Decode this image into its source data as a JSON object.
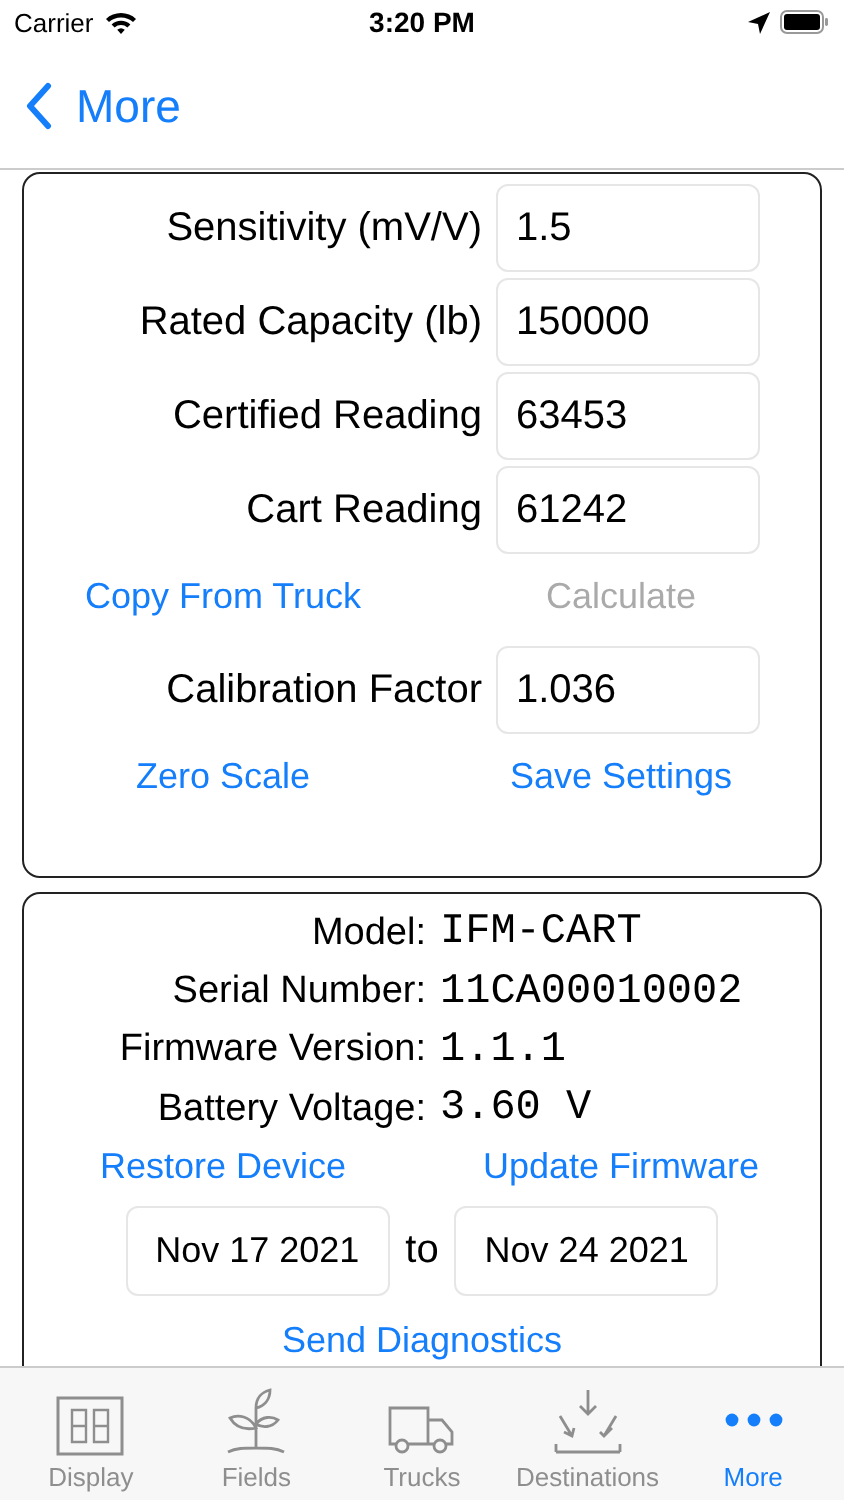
{
  "status_bar": {
    "carrier": "Carrier",
    "time": "3:20 PM"
  },
  "nav": {
    "back_label": "More"
  },
  "settings": {
    "fields": [
      {
        "label": "Sensitivity (mV/V)",
        "value": "1.5"
      },
      {
        "label": "Rated Capacity (lb)",
        "value": "150000"
      },
      {
        "label": "Certified Reading",
        "value": "63453"
      },
      {
        "label": "Cart Reading",
        "value": "61242"
      }
    ],
    "actions": [
      {
        "label": "Copy From Truck",
        "disabled": false
      },
      {
        "label": "Calculate",
        "disabled": true
      }
    ],
    "factor": {
      "label": "Calibration Factor",
      "value": "1.036"
    },
    "buttons": [
      {
        "label": "Zero Scale",
        "disabled": false
      },
      {
        "label": "Save Settings",
        "disabled": false
      }
    ]
  },
  "device": {
    "info": [
      {
        "label": "Model:",
        "value": "IFM-CART"
      },
      {
        "label": "Serial Number:",
        "value": "11CA00010002"
      },
      {
        "label": "Firmware Version:",
        "value": "1.1.1"
      },
      {
        "label": "Battery Voltage:",
        "value": "3.60 V"
      }
    ],
    "buttons": [
      {
        "label": "Restore Device",
        "disabled": false
      },
      {
        "label": "Update Firmware",
        "disabled": false
      }
    ],
    "date_from": "Nov 17 2021",
    "date_separator": "to",
    "date_to": "Nov 24 2021",
    "send_button": "Send Diagnostics"
  },
  "tabs": [
    {
      "label": "Display",
      "kind": "display",
      "selected": false
    },
    {
      "label": "Fields",
      "kind": "plant",
      "selected": false
    },
    {
      "label": "Trucks",
      "kind": "truck",
      "selected": false
    },
    {
      "label": "Destinations",
      "kind": "arrows",
      "selected": false
    },
    {
      "label": "More",
      "kind": "dots",
      "selected": true
    }
  ]
}
